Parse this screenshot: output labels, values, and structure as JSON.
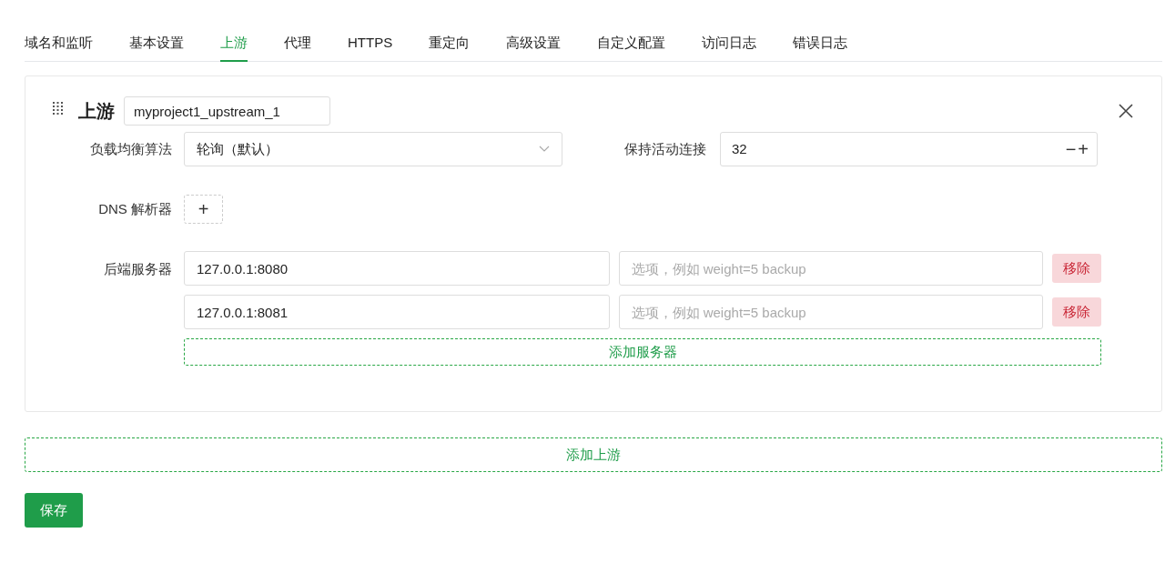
{
  "tabs": [
    {
      "label": "域名和监听",
      "selected": false
    },
    {
      "label": "基本设置",
      "selected": false
    },
    {
      "label": "上游",
      "selected": true
    },
    {
      "label": "代理",
      "selected": false
    },
    {
      "label": "HTTPS",
      "selected": false
    },
    {
      "label": "重定向",
      "selected": false
    },
    {
      "label": "高级设置",
      "selected": false
    },
    {
      "label": "自定义配置",
      "selected": false
    },
    {
      "label": "访问日志",
      "selected": false
    },
    {
      "label": "错误日志",
      "selected": false
    }
  ],
  "upstreams": [
    {
      "title": "上游",
      "name": "myproject1_upstream_1",
      "algorithm": {
        "label": "负载均衡算法",
        "value": "轮询（默认）"
      },
      "keepalive": {
        "label": "保持活动连接",
        "value": "32",
        "minus": "−",
        "plus": "+"
      },
      "dns": {
        "label": "DNS 解析器",
        "add": "+"
      },
      "servers_label": "后端服务器",
      "servers": [
        {
          "address": "127.0.0.1:8080",
          "options_placeholder": "选项，例如 weight=5 backup",
          "remove": "移除"
        },
        {
          "address": "127.0.0.1:8081",
          "options_placeholder": "选项，例如 weight=5 backup",
          "remove": "移除"
        }
      ],
      "add_server": "添加服务器"
    }
  ],
  "add_upstream": "添加上游",
  "save": "保存"
}
